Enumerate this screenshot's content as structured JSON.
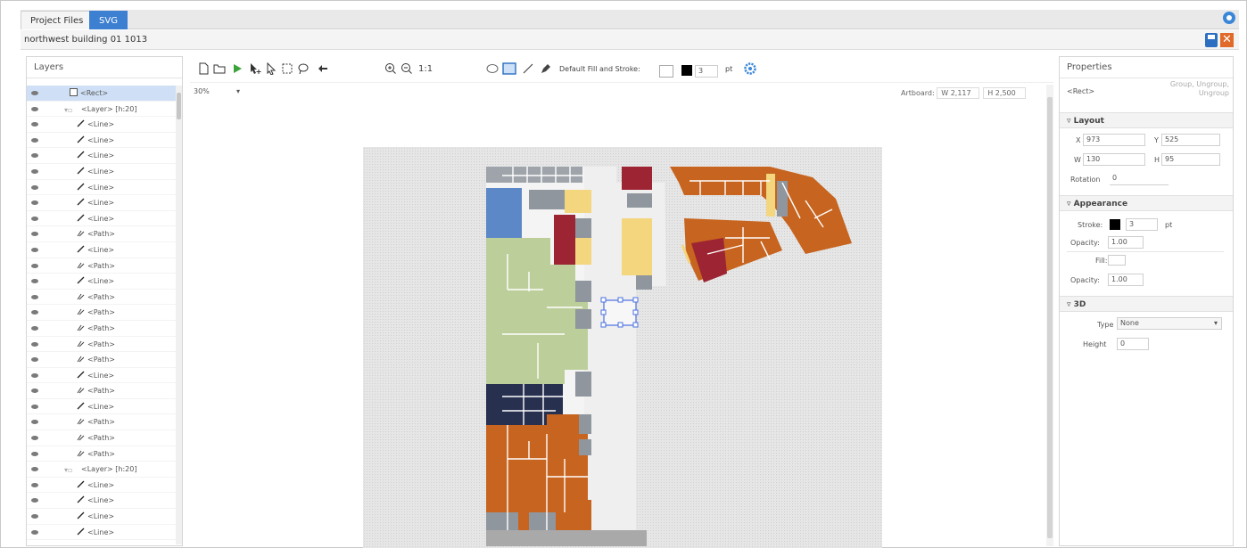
{
  "tabs": [
    {
      "label": "Project Files"
    },
    {
      "label": "SVG"
    }
  ],
  "document": {
    "title": "northwest building 01 1013"
  },
  "layers": {
    "title": "Layers",
    "rows": [
      {
        "label": "<Rect>",
        "indent": 0,
        "icon": "rect-icon",
        "selected": true
      },
      {
        "label": "<Layer> [h:20]",
        "indent": 1,
        "icon": "layer-icon"
      },
      {
        "label": "<Line>",
        "indent": 2,
        "icon": "line-icon"
      },
      {
        "label": "<Line>",
        "indent": 2,
        "icon": "line-icon"
      },
      {
        "label": "<Line>",
        "indent": 2,
        "icon": "line-icon"
      },
      {
        "label": "<Line>",
        "indent": 2,
        "icon": "line-icon"
      },
      {
        "label": "<Line>",
        "indent": 2,
        "icon": "line-icon"
      },
      {
        "label": "<Line>",
        "indent": 2,
        "icon": "line-icon"
      },
      {
        "label": "<Line>",
        "indent": 2,
        "icon": "line-icon"
      },
      {
        "label": "<Path>",
        "indent": 2,
        "icon": "path-icon"
      },
      {
        "label": "<Line>",
        "indent": 2,
        "icon": "line-icon"
      },
      {
        "label": "<Path>",
        "indent": 2,
        "icon": "path-icon"
      },
      {
        "label": "<Line>",
        "indent": 2,
        "icon": "line-icon"
      },
      {
        "label": "<Path>",
        "indent": 2,
        "icon": "path-icon"
      },
      {
        "label": "<Path>",
        "indent": 2,
        "icon": "path-icon"
      },
      {
        "label": "<Path>",
        "indent": 2,
        "icon": "path-icon"
      },
      {
        "label": "<Path>",
        "indent": 2,
        "icon": "path-icon"
      },
      {
        "label": "<Path>",
        "indent": 2,
        "icon": "path-icon"
      },
      {
        "label": "<Line>",
        "indent": 2,
        "icon": "line-icon"
      },
      {
        "label": "<Path>",
        "indent": 2,
        "icon": "path-icon"
      },
      {
        "label": "<Line>",
        "indent": 2,
        "icon": "line-icon"
      },
      {
        "label": "<Path>",
        "indent": 2,
        "icon": "path-icon"
      },
      {
        "label": "<Path>",
        "indent": 2,
        "icon": "path-icon"
      },
      {
        "label": "<Path>",
        "indent": 2,
        "icon": "path-icon"
      },
      {
        "label": "<Layer> [h:20]",
        "indent": 1,
        "icon": "layer-icon"
      },
      {
        "label": "<Line>",
        "indent": 2,
        "icon": "line-icon"
      },
      {
        "label": "<Line>",
        "indent": 2,
        "icon": "line-icon"
      },
      {
        "label": "<Line>",
        "indent": 2,
        "icon": "line-icon"
      },
      {
        "label": "<Line>",
        "indent": 2,
        "icon": "line-icon"
      }
    ]
  },
  "toolbar": {
    "zoom_one_label": "1:1",
    "fill_stroke_label": "Default Fill and Stroke:",
    "stroke_width": "3",
    "unit": "pt"
  },
  "canvas": {
    "zoom_value": "30%",
    "artboard_label": "Artboard:",
    "artboard_w": "W 2,117",
    "artboard_h": "H 2,500"
  },
  "properties": {
    "title": "Properties",
    "element": "<Rect>",
    "actions": "Group, Ungroup, Ungroup",
    "layout_title": "Layout",
    "x": "973",
    "y": "525",
    "w": "130",
    "h": "95",
    "x_label": "X",
    "y_label": "Y",
    "w_label": "W",
    "h_label": "H",
    "rotation_label": "Rotation",
    "rotation": "0",
    "appearance_title": "Appearance",
    "stroke_label": "Stroke:",
    "stroke_val": "3",
    "stroke_unit": "pt",
    "opacity_label": "Opacity:",
    "opacity1": "1.00",
    "fill_label": "Fill:",
    "opacity2": "1.00",
    "threed_title": "3D",
    "type_label": "Type",
    "type_val": "None",
    "height_label": "Height",
    "height_val": "0"
  },
  "colors": {
    "accent": "#3d7fd0",
    "orange": "#c7641f",
    "green": "#bccf9a",
    "navy": "#27304f",
    "red": "#9d2432",
    "gray": "#8f969d",
    "yellow": "#f3d67e",
    "blue": "#5c88c8"
  }
}
